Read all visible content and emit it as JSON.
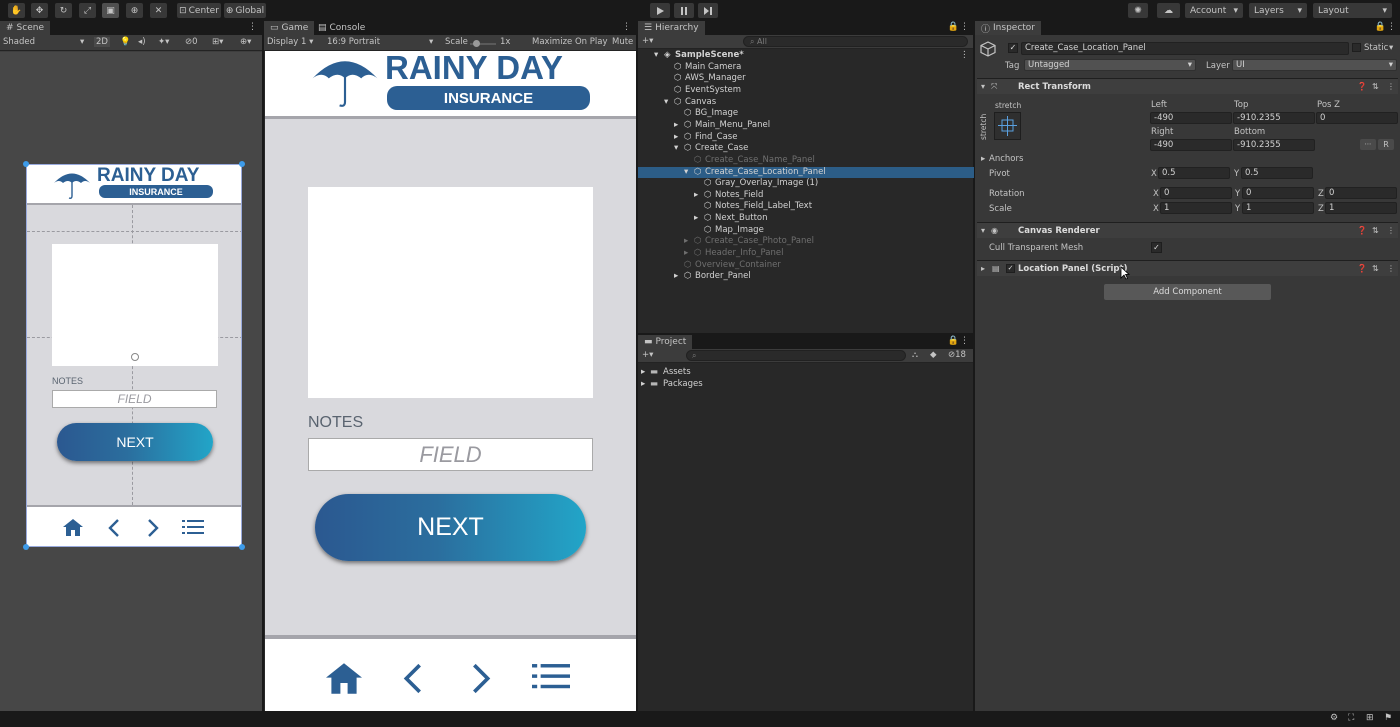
{
  "toolbar": {
    "center_label": "Center",
    "global_label": "Global",
    "account_label": "Account",
    "layers_label": "Layers",
    "layout_label": "Layout"
  },
  "scene": {
    "tab_label": "Scene",
    "shading": "Shaded",
    "mode_2d": "2D",
    "gizmo_count": "0"
  },
  "game": {
    "tab_label": "Game",
    "console_tab_label": "Console",
    "display": "Display 1",
    "aspect": "16:9 Portrait",
    "scale_label": "Scale",
    "scale_value": "1x",
    "maximize_label": "Maximize On Play",
    "mute_label": "Mute"
  },
  "app_preview": {
    "logo_title": "RAINY DAY",
    "logo_subtitle": "INSURANCE",
    "notes_label": "NOTES",
    "field_placeholder": "FIELD",
    "next_label": "NEXT",
    "brand_color": "#2c5f93",
    "nav_icons": [
      "home-icon",
      "chevron-left-icon",
      "chevron-right-icon",
      "list-icon"
    ]
  },
  "hierarchy": {
    "tab_label": "Hierarchy",
    "search_placeholder": "All",
    "rows": [
      {
        "label": "SampleScene*",
        "indent": 0,
        "state": "scene"
      },
      {
        "label": "Main Camera",
        "indent": 1,
        "state": "normal"
      },
      {
        "label": "AWS_Manager",
        "indent": 1,
        "state": "normal"
      },
      {
        "label": "EventSystem",
        "indent": 1,
        "state": "normal"
      },
      {
        "label": "Canvas",
        "indent": 1,
        "state": "open"
      },
      {
        "label": "BG_Image",
        "indent": 2,
        "state": "normal"
      },
      {
        "label": "Main_Menu_Panel",
        "indent": 2,
        "state": "closed"
      },
      {
        "label": "Find_Case",
        "indent": 2,
        "state": "closed"
      },
      {
        "label": "Create_Case",
        "indent": 2,
        "state": "open"
      },
      {
        "label": "Create_Case_Name_Panel",
        "indent": 3,
        "state": "dim"
      },
      {
        "label": "Create_Case_Location_Panel",
        "indent": 3,
        "state": "selected"
      },
      {
        "label": "Gray_Overlay_Image (1)",
        "indent": 4,
        "state": "normal"
      },
      {
        "label": "Notes_Field",
        "indent": 4,
        "state": "closed"
      },
      {
        "label": "Notes_Field_Label_Text",
        "indent": 4,
        "state": "normal"
      },
      {
        "label": "Next_Button",
        "indent": 4,
        "state": "closed"
      },
      {
        "label": "Map_Image",
        "indent": 4,
        "state": "normal"
      },
      {
        "label": "Create_Case_Photo_Panel",
        "indent": 3,
        "state": "dim"
      },
      {
        "label": "Header_Info_Panel",
        "indent": 3,
        "state": "dim"
      },
      {
        "label": "Overview_Container",
        "indent": 2,
        "state": "dim"
      },
      {
        "label": "Border_Panel",
        "indent": 2,
        "state": "closed"
      }
    ]
  },
  "project": {
    "tab_label": "Project",
    "hidden_count": "18",
    "folders": [
      "Assets",
      "Packages"
    ]
  },
  "inspector": {
    "tab_label": "Inspector",
    "object_name": "Create_Case_Location_Panel",
    "static_label": "Static",
    "tag_label": "Tag",
    "tag_value": "Untagged",
    "layer_label": "Layer",
    "layer_value": "UI",
    "rect_transform": {
      "title": "Rect Transform",
      "anchor_preset_top": "stretch",
      "anchor_preset_side": "stretch",
      "left_label": "Left",
      "left": "-490",
      "top_label": "Top",
      "top": "-910.2355",
      "posz_label": "Pos Z",
      "posz": "0",
      "right_label": "Right",
      "right": "-490",
      "bottom_label": "Bottom",
      "bottom": "-910.2355",
      "anchors_label": "Anchors",
      "pivot_label": "Pivot",
      "pivot_x": "0.5",
      "pivot_y": "0.5",
      "rotation_label": "Rotation",
      "rot_x": "0",
      "rot_y": "0",
      "rot_z": "0",
      "scale_label": "Scale",
      "scale_x": "1",
      "scale_y": "1",
      "scale_z": "1",
      "axis_x": "X",
      "axis_y": "Y",
      "axis_z": "Z",
      "r_button": "R"
    },
    "canvas_renderer": {
      "title": "Canvas Renderer",
      "cull_label": "Cull Transparent Mesh",
      "cull_checked": true
    },
    "script_component": {
      "title": "Location Panel (Script)"
    },
    "add_component_label": "Add Component"
  }
}
